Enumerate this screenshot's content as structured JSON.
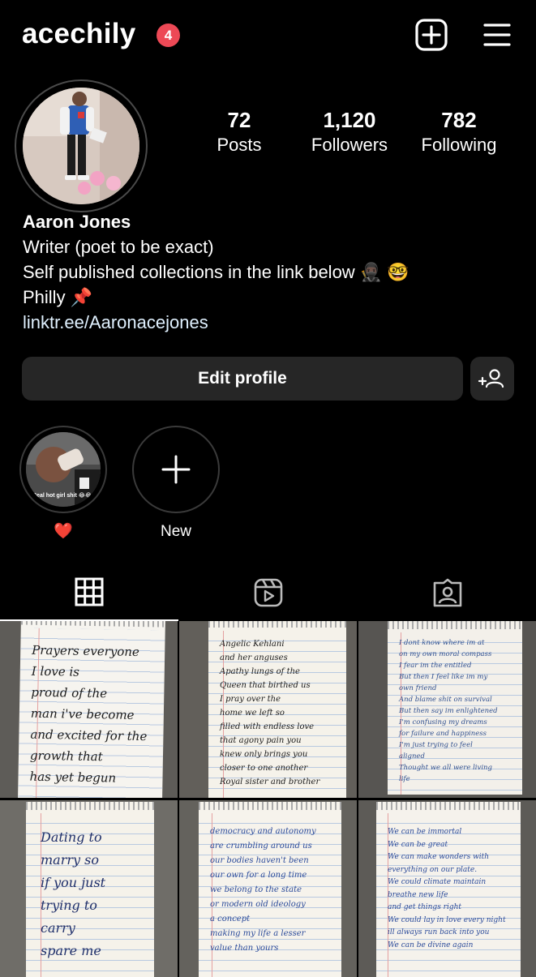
{
  "header": {
    "username": "acechily",
    "notification_count": "4",
    "icons": [
      "plus-square-icon",
      "hamburger-menu-icon"
    ]
  },
  "profile": {
    "stats": {
      "posts_count": "72",
      "posts_label": "Posts",
      "followers_count": "1,120",
      "followers_label": "Followers",
      "following_count": "782",
      "following_label": "Following"
    },
    "name": "Aaron Jones",
    "bio_line1": "Writer (poet to be exact)",
    "bio_line2": "Self published collections in the link below 🥷🏿 🤓",
    "bio_line3": "Philly 📌",
    "link": "linktr.ee/Aaronacejones"
  },
  "actions": {
    "edit_profile_label": "Edit profile"
  },
  "highlights": [
    {
      "label": "❤️",
      "cover_text": "Real hot girl shit 😂😂😂"
    },
    {
      "label": "New"
    }
  ],
  "tabs": [
    "grid-icon",
    "reels-icon",
    "tagged-icon"
  ],
  "posts": [
    {
      "text": "Prayers everyone\nI love is\nproud of the\nman i've become\nand excited for the\ngrowth that\nhas yet begun",
      "ink": "#1c1c1c"
    },
    {
      "text": "Angelic Kehlani\nand her anguses\nApathy lungs of the\nQueen that birthed us\nI pray over the\nhome we left so\nfilled with endless love\nthat agony pain you\nknew only brings you\ncloser to one another\nRoyal sister and brother",
      "ink": "#1c1c1c"
    },
    {
      "text": "I dont know where im at\non my own moral compass\nI fear im the entitled\nBut then I feel like im my\nown friend\nAnd blame shit on survival\nBut then say im enlightened\nI'm confusing my dreams\nfor failure and happiness\nI'm just trying to feel\naligned\nThought we all were living\nlife",
      "ink": "#2f4f8f"
    },
    {
      "text": "Dating to\nmarry so\nif you just\ntrying to\ncarry\nspare me",
      "ink": "#1f2f6a"
    },
    {
      "text": "democracy and autonomy\nare crumbling around us\nour bodies haven't been\nour own for a long time\nwe belong to the state\nor modern old ideology\na concept\nmaking my life a lesser\nvalue than yours",
      "ink": "#2a4a9a"
    },
    {
      "text": "We can be immortal\nWe can be great\nWe can make wonders with\neverything on our plate.\nWe could climate maintain\nbreathe new life\nand get things right\nWe could lay in love every night\nill always run back into you\nWe can be divine again",
      "ink": "#2a4a9a"
    }
  ],
  "colors": {
    "background": "#000000",
    "badge": "#ed4956",
    "button": "#262626",
    "link": "#e0f1ff"
  }
}
